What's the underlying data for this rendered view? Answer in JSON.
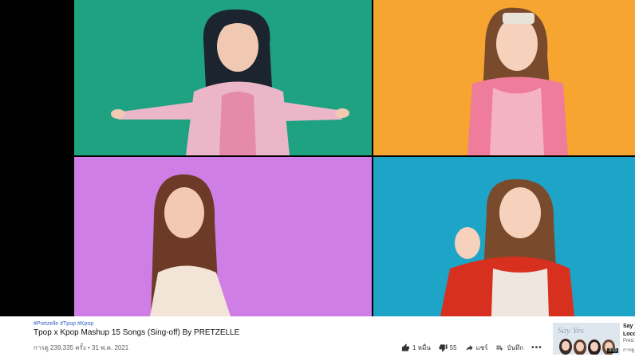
{
  "video": {
    "hashtags": [
      "#Pretzelle",
      "#Tpop",
      "#Kpop"
    ],
    "title": "Tpop x Kpop Mashup 15 Songs (Sing-off) By PRETZELLE",
    "views": "การดู 239,335 ครั้ง",
    "separator": "•",
    "date": "31 พ.ค. 2021"
  },
  "actions": {
    "like_count": "1 หมื่น",
    "dislike_count": "55",
    "share_label": "แชร์",
    "save_label": "บันทึก",
    "more_label": "•••"
  },
  "up_next": {
    "thumb_text": "Say Yes",
    "duration": "3:33",
    "title_line1": "Say Y",
    "title_line2": "Loco",
    "channel": "Pretz",
    "views": "การดู"
  },
  "colors": {
    "panel_green": "#1fa281",
    "panel_orange": "#f5a530",
    "panel_pink": "#cf7ee6",
    "panel_blue": "#1ea4c6",
    "link_blue": "#3760c8"
  }
}
